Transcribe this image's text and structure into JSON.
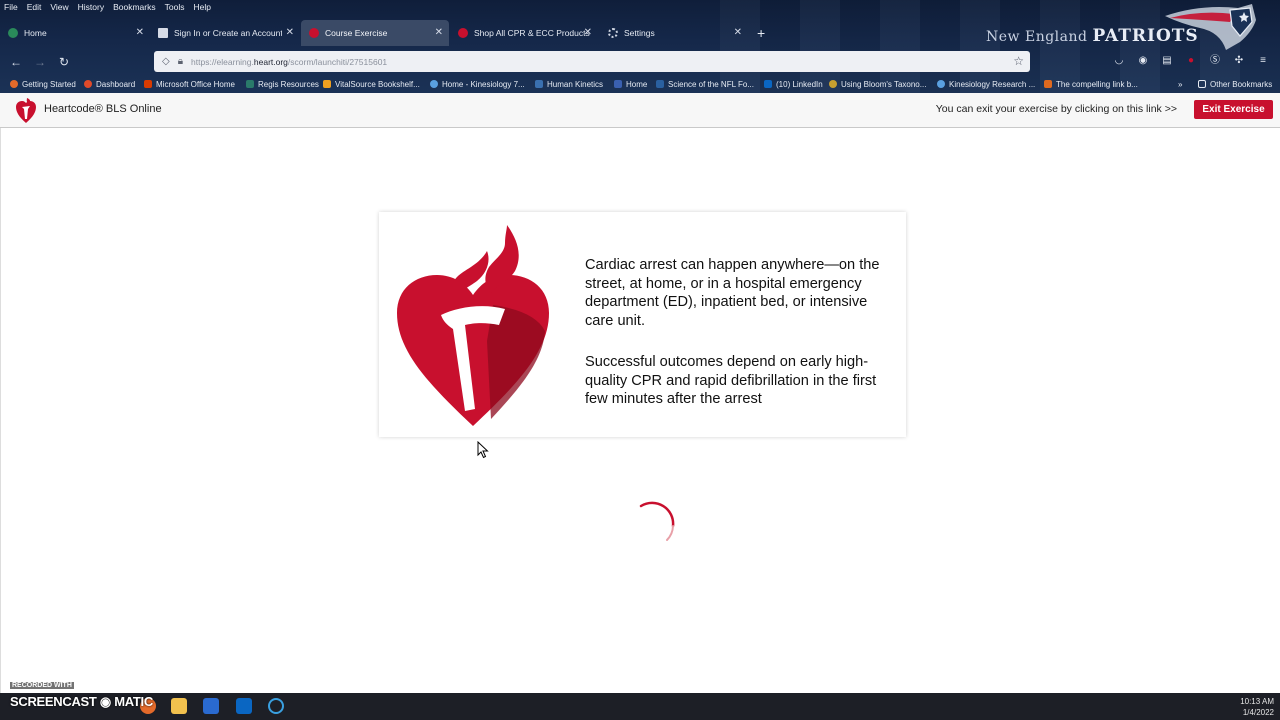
{
  "menubar": [
    "File",
    "Edit",
    "View",
    "History",
    "Bookmarks",
    "Tools",
    "Help"
  ],
  "theme": {
    "prefix": "New England",
    "name": "PATRIOTS"
  },
  "tabs": [
    {
      "label": "Home",
      "active": false,
      "favicon_color": "#2a8a5a"
    },
    {
      "label": "Sign In or Create an Account - A",
      "active": false,
      "favicon_color": "#d6dbe6"
    },
    {
      "label": "Course Exercise",
      "active": true,
      "favicon_color": "#c8102e"
    },
    {
      "label": "Shop All CPR & ECC Products",
      "active": false,
      "favicon_color": "#c8102e"
    },
    {
      "label": "Settings",
      "active": false,
      "favicon_color": "#cfd6e2"
    }
  ],
  "url": {
    "prefix": "https://elearning.",
    "domain": "heart.org",
    "path": "/scorm/launchiti/27515601"
  },
  "bookmarks": [
    "Getting Started",
    "Dashboard",
    "Microsoft Office Home",
    "Regis Resources",
    "VitalSource Bookshelf...",
    "Home - Kinesiology 7...",
    "Human Kinetics",
    "Home",
    "Science of the NFL Fo...",
    "(10) LinkedIn",
    "Using Bloom's Taxono...",
    "Kinesiology Research ...",
    "The compelling link b..."
  ],
  "other_bookmarks": "Other Bookmarks",
  "course": {
    "title": "Heartcode® BLS Online",
    "exit_hint": "You can exit your exercise by clicking on this link >>",
    "exit_label": "Exit Exercise"
  },
  "card": {
    "paragraph1": "Cardiac arrest can happen anywhere—on the street, at home, or in a hospital emergency department (ED), inpatient bed, or intensive care unit.",
    "paragraph2": "Successful outcomes depend on early high-quality CPR and rapid defibrillation in the first few minutes after the arrest"
  },
  "taskbar": {
    "time": "10:13 AM",
    "date": "1/4/2022"
  },
  "watermark": {
    "small": "RECORDED WITH",
    "brand": "SCREENCAST ◉ MATIC"
  },
  "colors": {
    "accent": "#c8102e",
    "chrome_dark": "#15284a"
  }
}
